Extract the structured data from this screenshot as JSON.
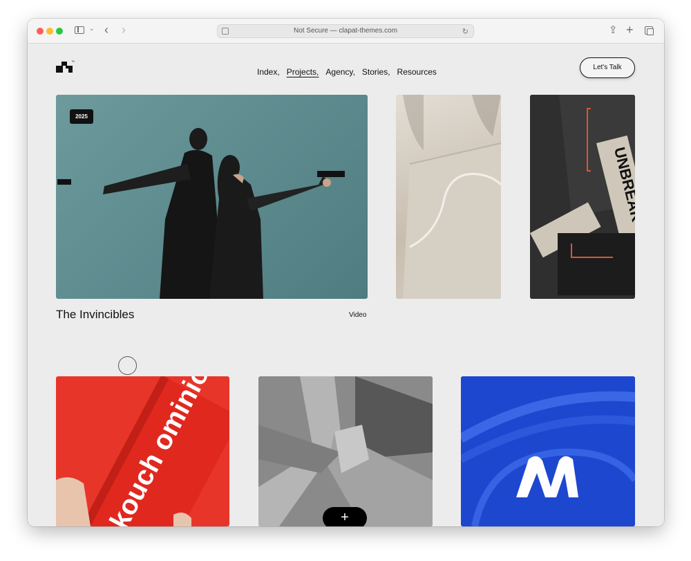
{
  "browser": {
    "url_text": "Not Secure — clapat-themes.com"
  },
  "header": {
    "logo_mark": "™",
    "nav": [
      {
        "label": "Index,"
      },
      {
        "label": "Projects,"
      },
      {
        "label": "Agency,"
      },
      {
        "label": "Stories,"
      },
      {
        "label": "Resources"
      }
    ],
    "cta_label": "Let's Talk"
  },
  "featured": {
    "year": "2025",
    "title": "The Invincibles",
    "category": "Video"
  },
  "grid": {
    "unbreak_text": "UNBREAK",
    "red_box_text": "kouch ominion",
    "plus_label": "+"
  },
  "colors": {
    "background": "#ececec",
    "accent_red": "#e8352a",
    "accent_blue": "#1f4fd6",
    "text": "#111111"
  }
}
